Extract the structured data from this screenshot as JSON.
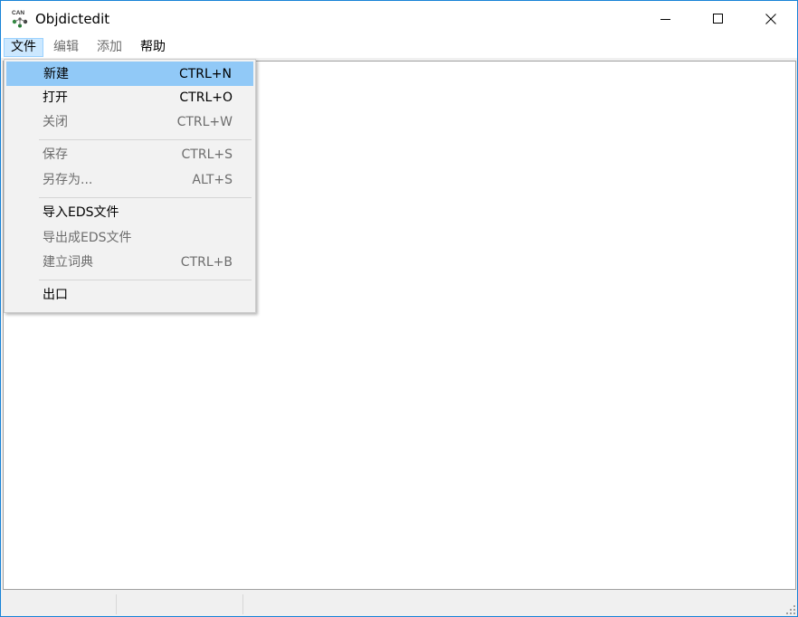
{
  "window": {
    "title": "Objdictedit",
    "app_icon": "can-network-icon",
    "controls": {
      "minimize": "minimize-icon",
      "maximize": "maximize-icon",
      "close": "close-icon"
    }
  },
  "menubar": {
    "items": [
      {
        "label": "文件",
        "state": "open"
      },
      {
        "label": "编辑",
        "state": "disabled"
      },
      {
        "label": "添加",
        "state": "disabled"
      },
      {
        "label": "帮助",
        "state": "enabled"
      }
    ]
  },
  "file_menu": {
    "items": [
      {
        "label": "新建",
        "shortcut": "CTRL+N",
        "enabled": true,
        "highlighted": true
      },
      {
        "label": "打开",
        "shortcut": "CTRL+O",
        "enabled": true
      },
      {
        "label": "关闭",
        "shortcut": "CTRL+W",
        "enabled": false
      },
      {
        "label": "保存",
        "shortcut": "CTRL+S",
        "enabled": false
      },
      {
        "label": "另存为...",
        "shortcut": "ALT+S",
        "enabled": false
      },
      {
        "label": "导入EDS文件",
        "shortcut": "",
        "enabled": true
      },
      {
        "label": "导出成EDS文件",
        "shortcut": "",
        "enabled": false
      },
      {
        "label": "建立词典",
        "shortcut": "CTRL+B",
        "enabled": false
      },
      {
        "label": "出口",
        "shortcut": "",
        "enabled": true
      }
    ]
  },
  "colors": {
    "highlight": "#91c9f7",
    "menu_open_bg": "#cce8ff",
    "disabled_text": "#6d6d6d",
    "window_border": "#1883d7"
  }
}
